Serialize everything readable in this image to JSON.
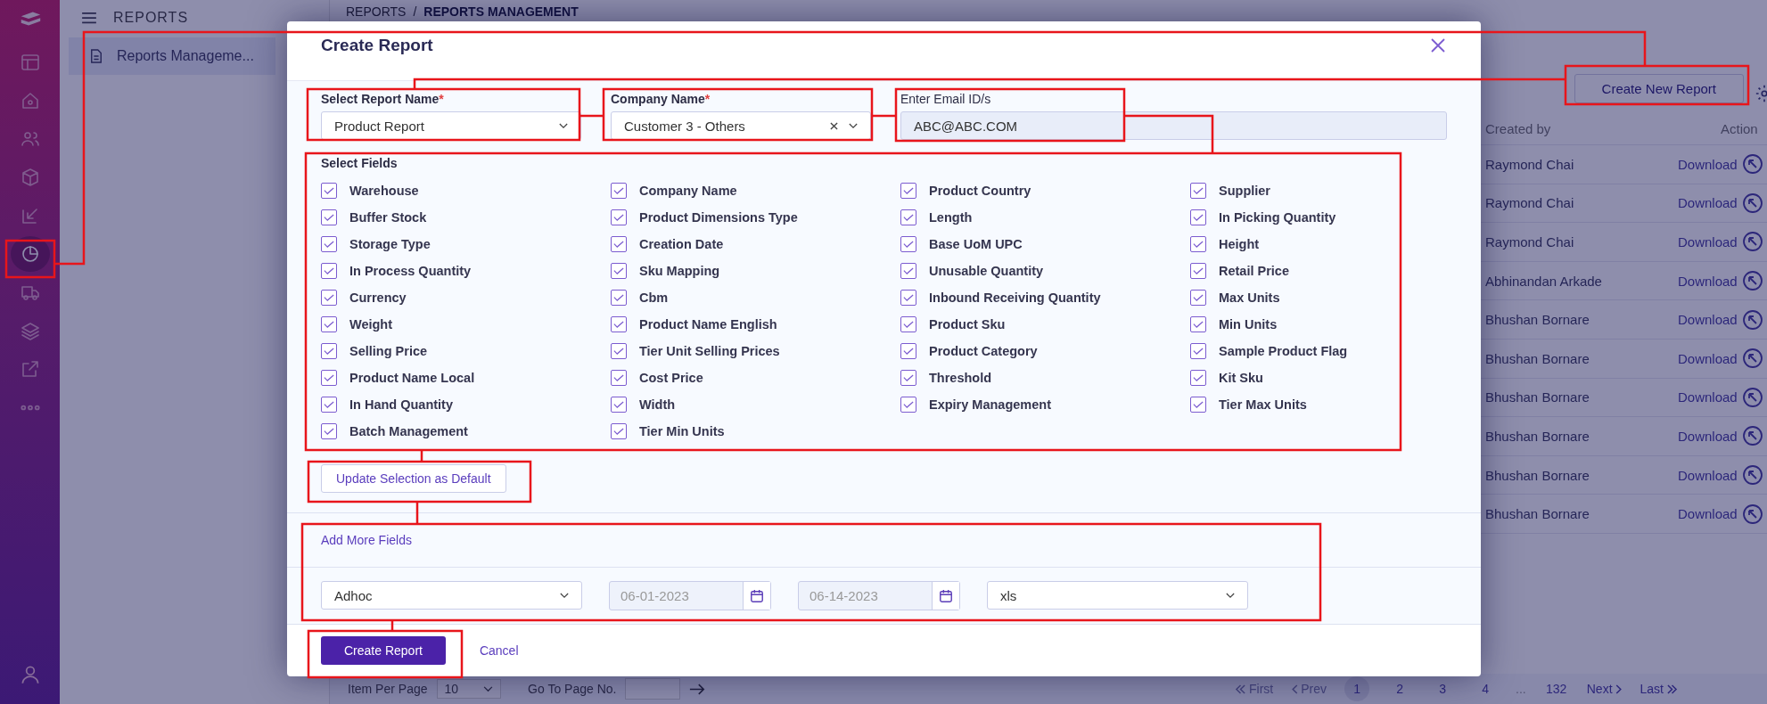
{
  "rail": {
    "items": [
      {
        "selected": false
      },
      {
        "selected": false
      },
      {
        "selected": false
      },
      {
        "selected": false
      },
      {
        "selected": false
      },
      {
        "selected": true
      },
      {
        "selected": false
      },
      {
        "selected": false
      },
      {
        "selected": false
      },
      {
        "selected": false
      }
    ]
  },
  "panel": {
    "title": "REPORTS",
    "items": [
      {
        "label": "Reports Manageme...",
        "selected": true
      }
    ]
  },
  "breadcrumb": {
    "items": [
      "REPORTS",
      "REPORTS MANAGEMENT"
    ],
    "separator": "/"
  },
  "toolbar": {
    "create_button": "Create New Report"
  },
  "table": {
    "columns": [
      "Created by",
      "Action"
    ],
    "rows": [
      {
        "created_by": "Raymond Chai",
        "action": "Download"
      },
      {
        "created_by": "Raymond Chai",
        "action": "Download"
      },
      {
        "created_by": "Raymond Chai",
        "action": "Download"
      },
      {
        "created_by": "Abhinandan Arkade",
        "action": "Download"
      },
      {
        "created_by": "Bhushan Bornare",
        "action": "Download"
      },
      {
        "created_by": "Bhushan Bornare",
        "action": "Download"
      },
      {
        "created_by": "Bhushan Bornare",
        "action": "Download"
      },
      {
        "created_by": "Bhushan Bornare",
        "action": "Download"
      },
      {
        "created_by": "Bhushan Bornare",
        "action": "Download"
      },
      {
        "created_by": "Bhushan Bornare",
        "action": "Download"
      }
    ]
  },
  "pagination": {
    "per_page_label": "Item Per Page",
    "per_page": "10",
    "goto_label": "Go To Page No.",
    "first": "First",
    "prev": "Prev",
    "pages": [
      {
        "label": "1",
        "selected": true
      },
      {
        "label": "2",
        "selected": false
      },
      {
        "label": "3",
        "selected": false
      },
      {
        "label": "4",
        "selected": false
      }
    ],
    "ellipsis": "...",
    "last_page": "132",
    "next": "Next",
    "last": "Last"
  },
  "modal": {
    "title": "Create Report",
    "report_name": {
      "label": "Select Report Name",
      "marker": "*",
      "value": "Product Report"
    },
    "company": {
      "label": "Company Name",
      "marker": "*",
      "value": "Customer 3 - Others"
    },
    "email": {
      "label": "Enter Email ID/s",
      "value": "ABC@ABC.COM"
    },
    "fields_label": "Select Fields",
    "fields": [
      {
        "label": "Warehouse",
        "checked": true
      },
      {
        "label": "Company Name",
        "checked": true
      },
      {
        "label": "Product Country",
        "checked": true
      },
      {
        "label": "Supplier",
        "checked": true
      },
      {
        "label": "Buffer Stock",
        "checked": true
      },
      {
        "label": "Product Dimensions Type",
        "checked": true
      },
      {
        "label": "Length",
        "checked": true
      },
      {
        "label": "In Picking Quantity",
        "checked": true
      },
      {
        "label": "Storage Type",
        "checked": true
      },
      {
        "label": "Creation Date",
        "checked": true
      },
      {
        "label": "Base UoM UPC",
        "checked": true
      },
      {
        "label": "Height",
        "checked": true
      },
      {
        "label": "In Process Quantity",
        "checked": true
      },
      {
        "label": "Sku Mapping",
        "checked": true
      },
      {
        "label": "Unusable Quantity",
        "checked": true
      },
      {
        "label": "Retail Price",
        "checked": true
      },
      {
        "label": "Currency",
        "checked": true
      },
      {
        "label": "Cbm",
        "checked": true
      },
      {
        "label": "Inbound Receiving Quantity",
        "checked": true
      },
      {
        "label": "Max Units",
        "checked": true
      },
      {
        "label": "Weight",
        "checked": true
      },
      {
        "label": "Product Name English",
        "checked": true
      },
      {
        "label": "Product Sku",
        "checked": true
      },
      {
        "label": "Min Units",
        "checked": true
      },
      {
        "label": "Selling Price",
        "checked": true
      },
      {
        "label": "Tier Unit Selling Prices",
        "checked": true
      },
      {
        "label": "Product Category",
        "checked": true
      },
      {
        "label": "Sample Product Flag",
        "checked": true
      },
      {
        "label": "Product Name Local",
        "checked": true
      },
      {
        "label": "Cost Price",
        "checked": true
      },
      {
        "label": "Threshold",
        "checked": true
      },
      {
        "label": "Kit Sku",
        "checked": true
      },
      {
        "label": "In Hand Quantity",
        "checked": true
      },
      {
        "label": "Width",
        "checked": true
      },
      {
        "label": "Expiry Management",
        "checked": true
      },
      {
        "label": "Tier Max Units",
        "checked": true
      },
      {
        "label": "Batch Management",
        "checked": true
      },
      {
        "label": "Tier Min Units",
        "checked": true
      }
    ],
    "update_button": "Update Selection as Default",
    "tabs": [
      {
        "label": "Add More Fields",
        "selected": true
      }
    ],
    "frequency": "Adhoc",
    "start_date": "06-01-2023",
    "end_date": "06-14-2023",
    "format": "xls",
    "submit": "Create Report",
    "cancel": "Cancel"
  }
}
